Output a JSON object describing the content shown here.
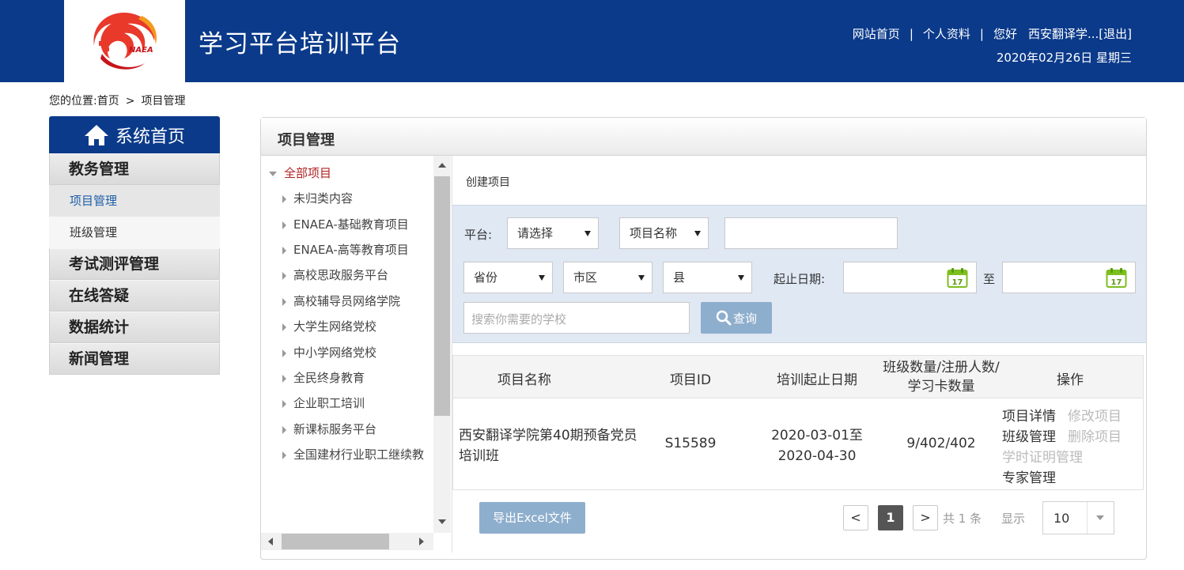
{
  "header": {
    "site_title": "学习平台培训平台",
    "logo_text": "NAEA",
    "links": {
      "home": "网站首页",
      "separator": "|",
      "profile": "个人资料",
      "greeting": "您好",
      "user": "西安翻译学...",
      "logout": "[退出]"
    },
    "date": "2020年02月26日 星期三"
  },
  "breadcrumb": {
    "prefix": "您的位置:",
    "home": "首页",
    "arrow": ">",
    "current": "项目管理"
  },
  "sidebar": {
    "home_label": "系统首页",
    "sections": [
      {
        "label": "教务管理",
        "items": [
          "项目管理",
          "班级管理"
        ]
      },
      {
        "label": "考试测评管理"
      },
      {
        "label": "在线答疑"
      },
      {
        "label": "数据统计"
      },
      {
        "label": "新闻管理"
      }
    ]
  },
  "panel": {
    "title": "项目管理"
  },
  "tree": {
    "root": "全部项目",
    "children": [
      "未归类内容",
      "ENAEA-基础教育项目",
      "ENAEA-高等教育项目",
      "高校思政服务平台",
      "高校辅导员网络学院",
      "大学生网络党校",
      "中小学网络党校",
      "全民终身教育",
      "企业职工培训",
      "新课标服务平台",
      "全国建材行业职工继续教"
    ]
  },
  "content": {
    "create_link": "创建项目",
    "filters": {
      "platform_label": "平台:",
      "platform_select": "请选择",
      "name_select": "项目名称",
      "name_input": "",
      "province_select": "省份",
      "city_select": "市区",
      "county_select": "县",
      "date_label": "起止日期:",
      "date_to": "至",
      "calendar_day": "17",
      "school_placeholder": "搜索你需要的学校",
      "query_button": "查询"
    },
    "table": {
      "columns": [
        "项目名称",
        "项目ID",
        "培训起止日期",
        "班级数量/注册人数/学习卡数量",
        "操作"
      ],
      "rows": [
        {
          "name": "西安翻译学院第40期预备党员培训班",
          "id": "S15589",
          "dates": "2020-03-01至2020-04-30",
          "counts": "9/402/402",
          "ops": [
            {
              "label": "项目详情",
              "enabled": true
            },
            {
              "label": "修改项目",
              "enabled": false
            },
            {
              "label": "班级管理",
              "enabled": true
            },
            {
              "label": "删除项目",
              "enabled": false
            },
            {
              "label": "学时证明管理",
              "enabled": false
            },
            {
              "label": "专家管理",
              "enabled": true
            }
          ]
        }
      ]
    },
    "export_button": "导出Excel文件",
    "pagination": {
      "prev": "<",
      "current": "1",
      "next": ">",
      "total_text": "共 1 条",
      "show_label": "显示",
      "page_size": "10"
    }
  },
  "colors": {
    "header_bg": "#0b3a8a",
    "filter_bg": "#dfe8f3",
    "button_bg": "#8eaecd",
    "tree_root": "#b22222",
    "calendar_green": "#7cbf1e"
  }
}
